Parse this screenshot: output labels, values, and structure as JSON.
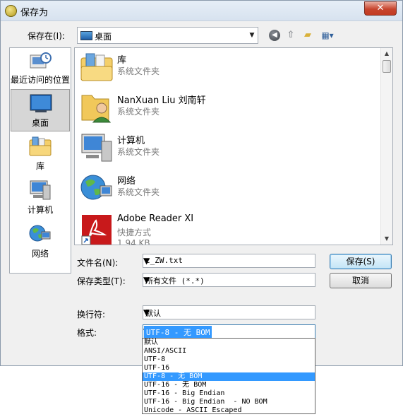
{
  "window": {
    "title": "保存为",
    "close_glyph": "✕"
  },
  "toolbar": {
    "save_in_label": "保存在(I):",
    "location": "桌面",
    "icons": [
      "back-icon",
      "up-folder-icon",
      "new-folder-icon",
      "views-icon"
    ]
  },
  "places": [
    {
      "label": "最近访问的位置",
      "icon": "recent-places-icon",
      "selected": false
    },
    {
      "label": "桌面",
      "icon": "desktop-icon",
      "selected": true
    },
    {
      "label": "库",
      "icon": "libraries-icon",
      "selected": false
    },
    {
      "label": "计算机",
      "icon": "computer-icon",
      "selected": false
    },
    {
      "label": "网络",
      "icon": "network-icon",
      "selected": false
    }
  ],
  "files": [
    {
      "name": "库",
      "type": "系统文件夹",
      "icon": "libraries-folder-icon"
    },
    {
      "name": "NanXuan Liu 刘南轩",
      "type": "系统文件夹",
      "icon": "user-folder-icon"
    },
    {
      "name": "计算机",
      "type": "系统文件夹",
      "icon": "computer-icon"
    },
    {
      "name": "网络",
      "type": "系统文件夹",
      "icon": "network-globe-icon"
    },
    {
      "name": "Adobe Reader XI",
      "type": "快捷方式",
      "size": "1.94 KB",
      "icon": "adobe-reader-icon"
    }
  ],
  "form": {
    "filename_label": "文件名(N):",
    "filename_value": "c_ZW.txt",
    "filetype_label": "保存类型(T):",
    "filetype_value": "所有文件 (*.*)",
    "linebreak_label": "换行符:",
    "linebreak_value": "默认",
    "format_label": "格式:",
    "format_value": "UTF-8 - 无 BOM"
  },
  "buttons": {
    "save": "保存(S)",
    "cancel": "取消"
  },
  "format_options": {
    "items": [
      "默认",
      "ANSI/ASCII",
      "UTF-8",
      "UTF-16",
      "UTF-8 - 无 BOM",
      "UTF-16 - 无 BOM",
      "UTF-16 - Big Endian",
      "UTF-16 - Big Endian  - NO BOM",
      "Unicode - ASCII Escaped"
    ],
    "selected_index": 4
  },
  "colors": {
    "selection": "#3399ff",
    "dialog_bg": "#f0f0f0",
    "title_close": "#c7452e"
  }
}
